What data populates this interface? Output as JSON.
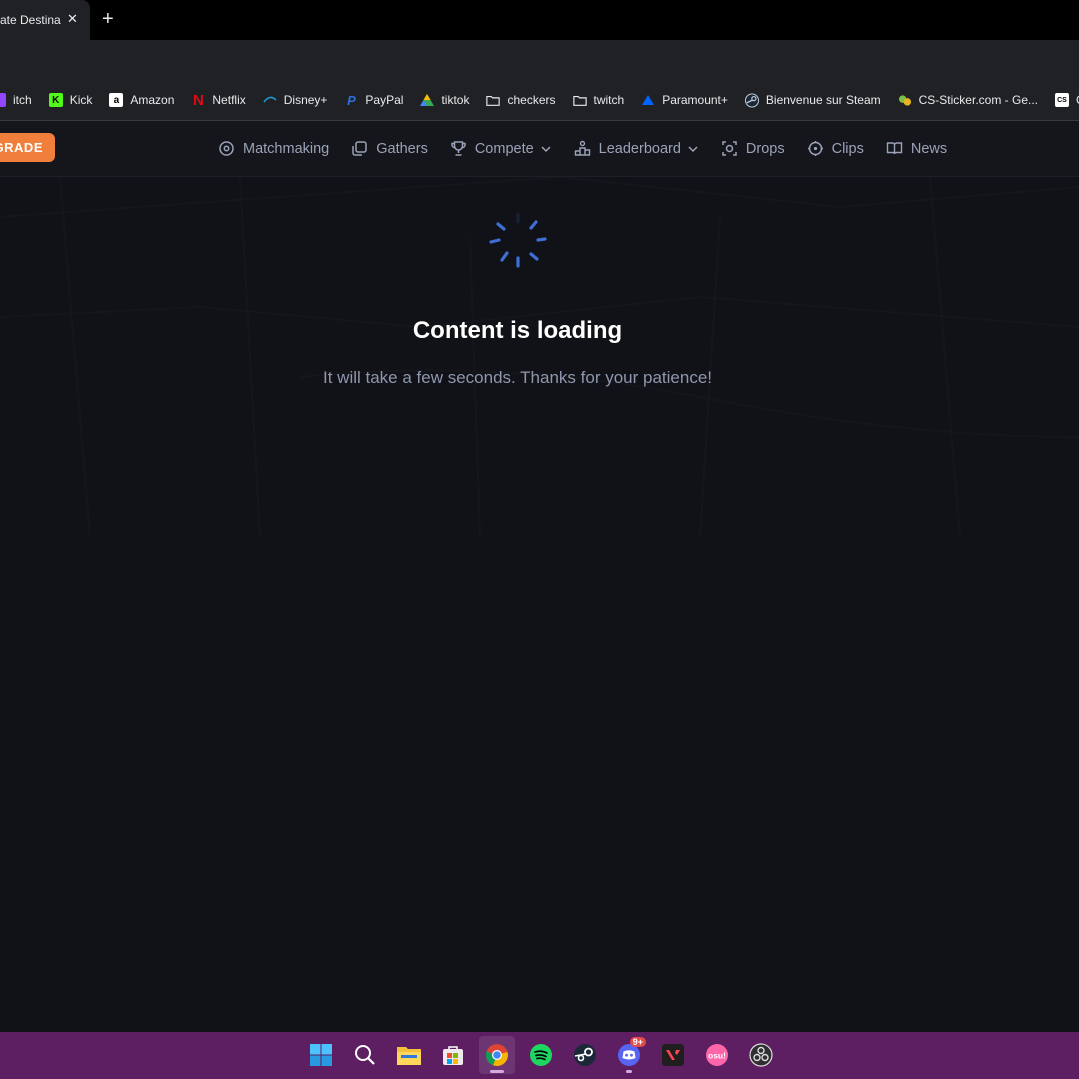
{
  "browser": {
    "tab_title": "ate Destina",
    "tab_close": "✕",
    "new_tab": "+"
  },
  "bookmarks": [
    {
      "label": "itch",
      "icon": "twitch-icon",
      "color": "#9146ff"
    },
    {
      "label": "Kick",
      "icon": "kick-icon",
      "color": "#53fc18"
    },
    {
      "label": "Amazon",
      "icon": "amazon-icon",
      "color": "#ffffff"
    },
    {
      "label": "Netflix",
      "icon": "netflix-icon",
      "color": "#e50914"
    },
    {
      "label": "Disney+",
      "icon": "disney-icon",
      "color": "#1a9bd6"
    },
    {
      "label": "PayPal",
      "icon": "paypal-icon",
      "color": "#2a6fdb"
    },
    {
      "label": "tiktok",
      "icon": "drive-icon",
      "color": "#34a853"
    },
    {
      "label": "checkers",
      "icon": "folder-icon",
      "color": "#e8eaed"
    },
    {
      "label": "twitch",
      "icon": "folder-icon",
      "color": "#e8eaed"
    },
    {
      "label": "Paramount+",
      "icon": "paramount-icon",
      "color": "#0064ff"
    },
    {
      "label": "Bienvenue sur Steam",
      "icon": "steam-icon",
      "color": "#c7d5e0"
    },
    {
      "label": "CS-Sticker.com - Ge...",
      "icon": "sticker-icon",
      "color": "#7bc043"
    },
    {
      "label": "Cu",
      "icon": "cs-icon",
      "color": "#ffffff"
    }
  ],
  "site": {
    "upgrade_label": "GRADE",
    "nav": [
      {
        "label": "Matchmaking",
        "icon": "matchmaking-icon"
      },
      {
        "label": "Gathers",
        "icon": "gathers-icon"
      },
      {
        "label": "Compete",
        "icon": "trophy-icon",
        "dropdown": true
      },
      {
        "label": "Leaderboard",
        "icon": "leaderboard-icon",
        "dropdown": true
      },
      {
        "label": "Drops",
        "icon": "drops-icon"
      },
      {
        "label": "Clips",
        "icon": "clips-icon"
      },
      {
        "label": "News",
        "icon": "news-icon"
      }
    ]
  },
  "loading": {
    "title": "Content is loading",
    "subtitle": "It will take a few seconds. Thanks for your patience!",
    "spinner_color": "#3d6fd6"
  },
  "taskbar": {
    "discord_badge": "9+",
    "osu_label": "osu!",
    "apps": [
      "start-icon",
      "search-icon",
      "file-explorer-icon",
      "store-icon",
      "chrome-icon",
      "spotify-icon",
      "steam-icon",
      "discord-icon",
      "valorant-icon",
      "osu-icon",
      "obs-icon"
    ]
  },
  "colors": {
    "accent": "#f07f3c",
    "taskbar": "#5d1f62",
    "nav_text": "#9aa3b8"
  }
}
